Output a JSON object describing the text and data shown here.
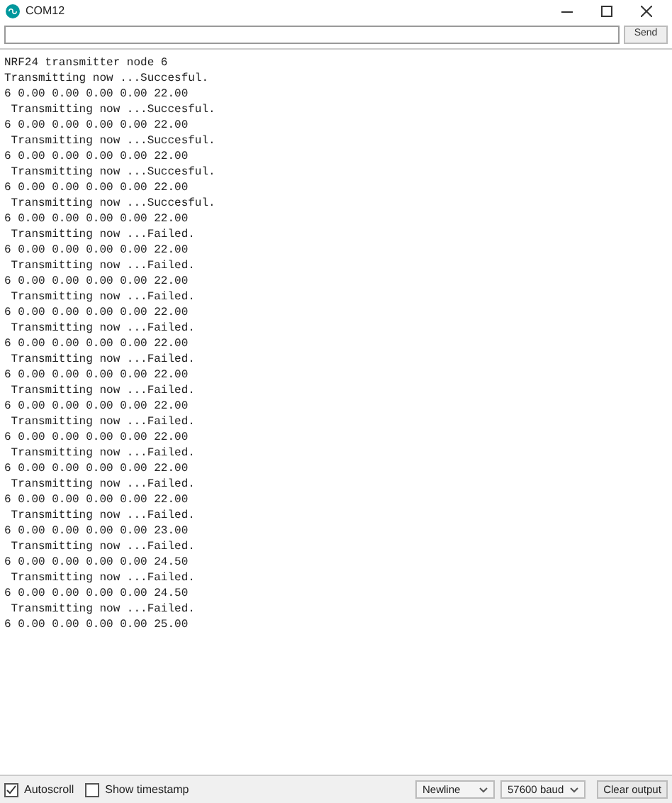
{
  "window": {
    "title": "COM12"
  },
  "send_button": "Send",
  "output_lines": [
    "NRF24 transmitter node 6",
    "Transmitting now ...Succesful.",
    "6 0.00 0.00 0.00 0.00 22.00",
    " Transmitting now ...Succesful.",
    "6 0.00 0.00 0.00 0.00 22.00",
    " Transmitting now ...Succesful.",
    "6 0.00 0.00 0.00 0.00 22.00",
    " Transmitting now ...Succesful.",
    "6 0.00 0.00 0.00 0.00 22.00",
    " Transmitting now ...Succesful.",
    "6 0.00 0.00 0.00 0.00 22.00",
    " Transmitting now ...Failed.",
    "6 0.00 0.00 0.00 0.00 22.00",
    " Transmitting now ...Failed.",
    "6 0.00 0.00 0.00 0.00 22.00",
    " Transmitting now ...Failed.",
    "6 0.00 0.00 0.00 0.00 22.00",
    " Transmitting now ...Failed.",
    "6 0.00 0.00 0.00 0.00 22.00",
    " Transmitting now ...Failed.",
    "6 0.00 0.00 0.00 0.00 22.00",
    " Transmitting now ...Failed.",
    "6 0.00 0.00 0.00 0.00 22.00",
    " Transmitting now ...Failed.",
    "6 0.00 0.00 0.00 0.00 22.00",
    " Transmitting now ...Failed.",
    "6 0.00 0.00 0.00 0.00 22.00",
    " Transmitting now ...Failed.",
    "6 0.00 0.00 0.00 0.00 22.00",
    " Transmitting now ...Failed.",
    "6 0.00 0.00 0.00 0.00 23.00",
    " Transmitting now ...Failed.",
    "6 0.00 0.00 0.00 0.00 24.50",
    " Transmitting now ...Failed.",
    "6 0.00 0.00 0.00 0.00 24.50",
    " Transmitting now ...Failed.",
    "6 0.00 0.00 0.00 0.00 25.00"
  ],
  "footer": {
    "autoscroll": {
      "label": "Autoscroll",
      "checked": true
    },
    "timestamp": {
      "label": "Show timestamp",
      "checked": false
    },
    "line_ending": "Newline",
    "baud": "57600 baud",
    "clear_button": "Clear output"
  }
}
